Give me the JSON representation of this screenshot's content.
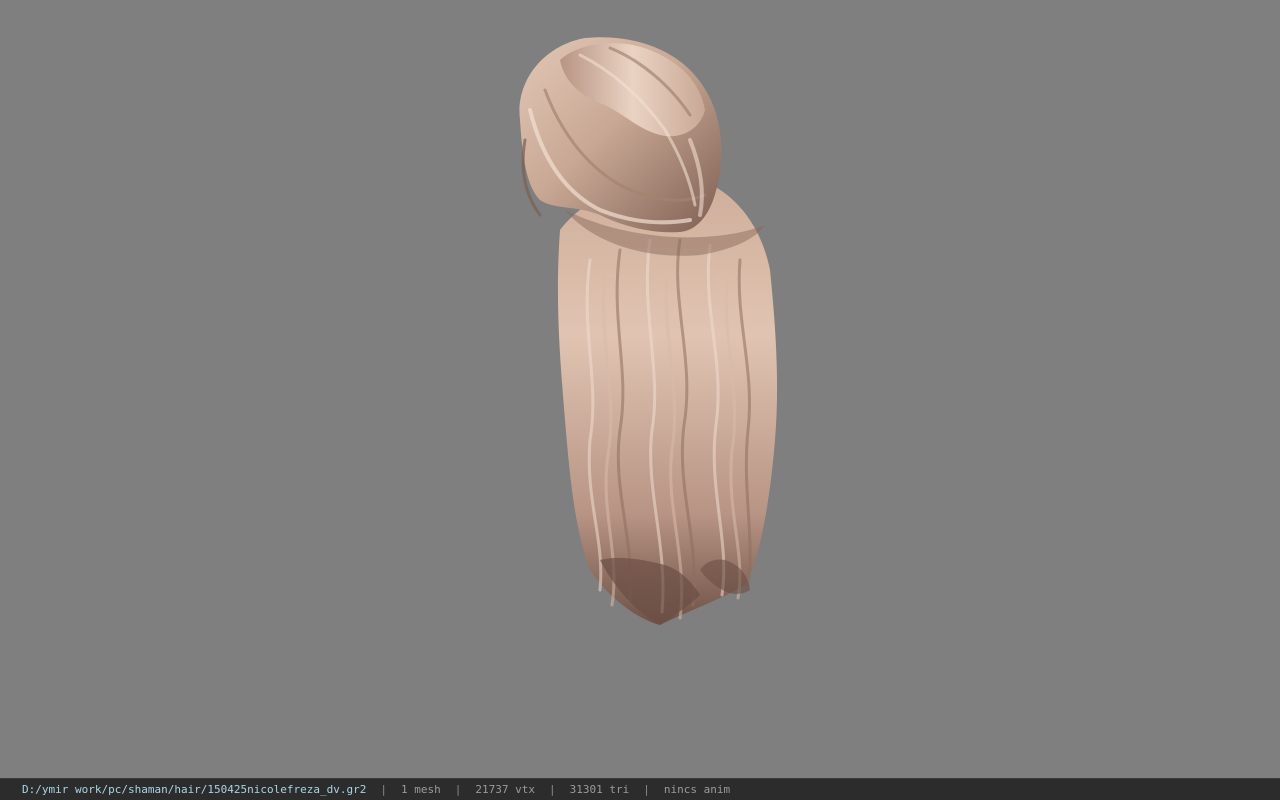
{
  "viewport": {
    "background_color": "#7f7f7f",
    "model": {
      "name": "hair-model",
      "colors": {
        "highlight": "#ead3c3",
        "base": "#c9a895",
        "shadow": "#8e6e60",
        "deep_shadow": "#5e463e"
      }
    }
  },
  "status_bar": {
    "file_path": "D:/ymir work/pc/shaman/hair/150425nicolefreza_dv.gr2",
    "separator": "|",
    "mesh_count": "1 mesh",
    "vertex_count": "21737 vtx",
    "triangle_count": "31301 tri",
    "anim_status": "nincs anim"
  }
}
